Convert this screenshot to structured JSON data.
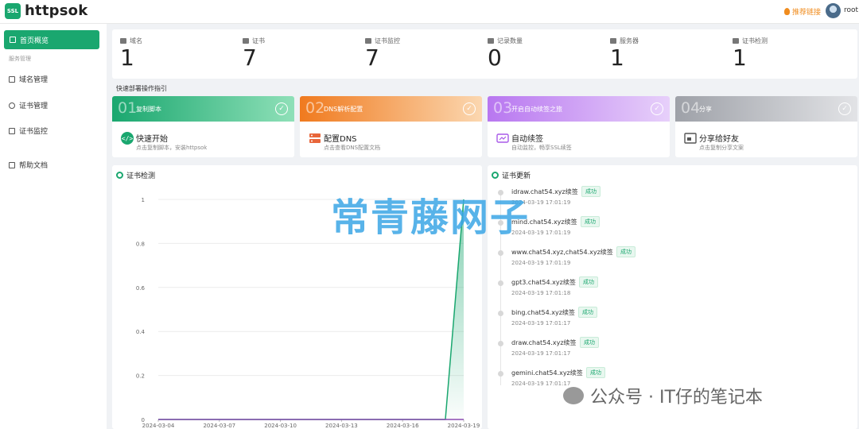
{
  "header": {
    "logo_text": "SSL",
    "brand": "httpsok",
    "rec_link": "推荐链接",
    "user": "root"
  },
  "sidebar": {
    "active": "首页概览",
    "group_label": "服务管理",
    "items": [
      "域名管理",
      "证书管理",
      "证书监控",
      "帮助文档"
    ]
  },
  "stats": [
    {
      "label": "域名",
      "value": "1",
      "icon": "monitor-icon"
    },
    {
      "label": "证书",
      "value": "7",
      "icon": "layers-icon"
    },
    {
      "label": "证书监控",
      "value": "7",
      "icon": "clipboard-icon"
    },
    {
      "label": "记录数量",
      "value": "0",
      "icon": "file-icon"
    },
    {
      "label": "服务器",
      "value": "1",
      "icon": "cube-icon"
    },
    {
      "label": "证书检测",
      "value": "1",
      "icon": "grid-icon"
    }
  ],
  "guide_title": "快速部署操作指引",
  "steps": [
    {
      "num": "01",
      "title": "复制脚本",
      "body_title": "快速开始",
      "body_sub": "点击复制脚本，安装httpsok",
      "color_from": "#1aa76f",
      "color_to": "#8fe0b8"
    },
    {
      "num": "02",
      "title": "DNS解析配置",
      "body_title": "配置DNS",
      "body_sub": "点击查看DNS配置文档",
      "color_from": "#f07a1e",
      "color_to": "#fbd7b0"
    },
    {
      "num": "03",
      "title": "开启自动续签之旅",
      "body_title": "自动续签",
      "body_sub": "自动监控，畅享SSL续签",
      "color_from": "#b877f0",
      "color_to": "#e7d0fa"
    },
    {
      "num": "04",
      "title": "分享",
      "body_title": "分享给好友",
      "body_sub": "点击复制分享文案",
      "color_from": "#9ea1a8",
      "color_to": "#e2e3e6"
    }
  ],
  "chart_panel": {
    "title": "证书检测"
  },
  "chart_data": {
    "type": "line",
    "x": [
      "2024-03-04",
      "2024-03-07",
      "2024-03-10",
      "2024-03-13",
      "2024-03-16",
      "2024-03-19"
    ],
    "ylim": [
      0,
      1
    ],
    "y_ticks": [
      "0",
      "0.2",
      "0.4",
      "0.6",
      "0.8",
      "1"
    ],
    "series": [
      {
        "color": "#1aa76f",
        "values": [
          0,
          0,
          0,
          0,
          0,
          1
        ]
      },
      {
        "color": "#8a4bb0",
        "values": [
          0,
          0,
          0,
          0,
          0,
          0
        ]
      }
    ],
    "grid": true
  },
  "updates_panel": {
    "title": "证书更新",
    "items": [
      {
        "name": "idraw.chat54.xyz续签",
        "status": "成功",
        "time": "2024-03-19 17:01:19"
      },
      {
        "name": "mind.chat54.xyz续签",
        "status": "成功",
        "time": "2024-03-19 17:01:19"
      },
      {
        "name": "www.chat54.xyz,chat54.xyz续签",
        "status": "成功",
        "time": "2024-03-19 17:01:19"
      },
      {
        "name": "gpt3.chat54.xyz续签",
        "status": "成功",
        "time": "2024-03-19 17:01:18"
      },
      {
        "name": "bing.chat54.xyz续签",
        "status": "成功",
        "time": "2024-03-19 17:01:17"
      },
      {
        "name": "draw.chat54.xyz续签",
        "status": "成功",
        "time": "2024-03-19 17:01:17"
      },
      {
        "name": "gemini.chat54.xyz续签",
        "status": "成功",
        "time": "2024-03-19 17:01:17"
      }
    ]
  },
  "watermarks": {
    "big": "常青藤网子",
    "small": "公众号 · IT仔的笔记本"
  }
}
